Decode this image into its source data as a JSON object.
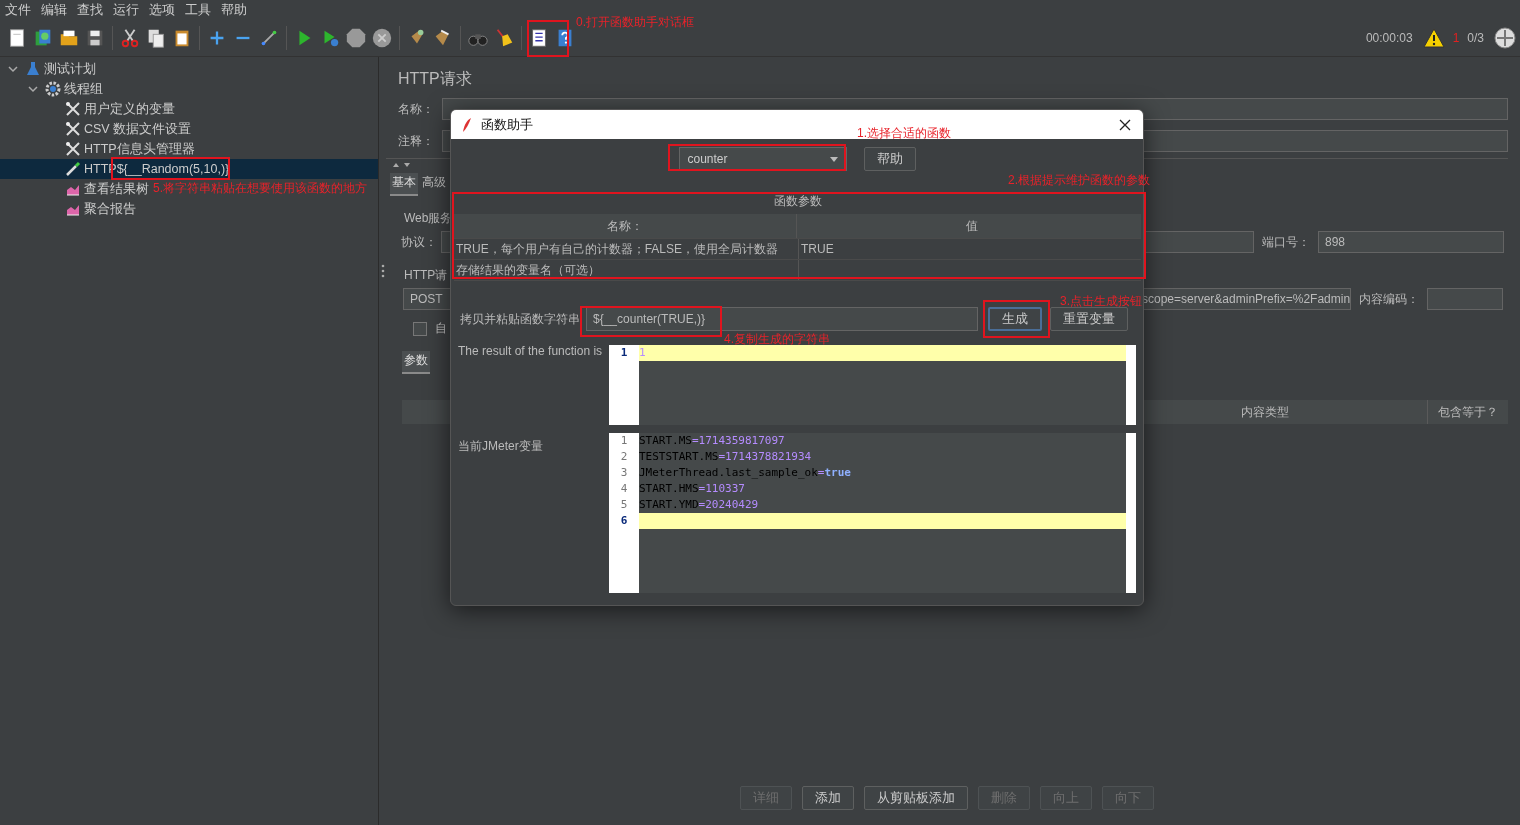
{
  "menu": [
    "文件",
    "编辑",
    "查找",
    "运行",
    "选项",
    "工具",
    "帮助"
  ],
  "status": {
    "elapsed": "00:00:03",
    "errors": "1",
    "threads": "0/3"
  },
  "tree": [
    {
      "label": "测试计划",
      "kind": "plan",
      "expanded": true,
      "selected": false,
      "children": [
        {
          "label": "线程组",
          "kind": "threads",
          "expanded": true,
          "selected": false,
          "children": [
            {
              "label": "用户定义的变量",
              "kind": "config",
              "selected": false
            },
            {
              "label": "CSV 数据文件设置",
              "kind": "config",
              "selected": false
            },
            {
              "label": "HTTP信息头管理器",
              "kind": "config",
              "selected": false
            },
            {
              "label": "HTTP${__Random(5,10,)}",
              "kind": "sampler",
              "selected": true
            },
            {
              "label": "查看结果树",
              "kind": "listener",
              "selected": false
            },
            {
              "label": "聚合报告",
              "kind": "listener",
              "selected": false
            }
          ]
        }
      ]
    }
  ],
  "sampler": {
    "title": "HTTP请求",
    "name_label": "名称：",
    "comment_label": "注释：",
    "tabs": [
      {
        "label": "基本",
        "selected": true
      },
      {
        "label": "高级",
        "selected": false
      }
    ],
    "web_group": "Web服务",
    "protocol_label": "协议：",
    "port_label": "端口号：",
    "port": "898",
    "request_group": "HTTP请",
    "method": "POST",
    "path": "scope=server&adminPrefix=%2Fadmin",
    "encoding_label": "内容编码：",
    "auto": {
      "label": "自",
      "checked": false
    },
    "param_tabs": [
      {
        "label": "参数",
        "selected": true
      }
    ],
    "columns": [
      "内容类型",
      "包含等于？"
    ],
    "buttons": [
      {
        "label": "详细",
        "disabled": true
      },
      {
        "label": "添加",
        "disabled": false
      },
      {
        "label": "从剪贴板添加",
        "disabled": false
      },
      {
        "label": "删除",
        "disabled": true
      },
      {
        "label": "向上",
        "disabled": true
      },
      {
        "label": "向下",
        "disabled": true
      }
    ]
  },
  "dialog": {
    "title": "函数助手",
    "function": "counter",
    "help_button": "帮助",
    "params_title": "函数参数",
    "param_columns": [
      "名称：",
      "值"
    ],
    "params": [
      {
        "name": "TRUE，每个用户有自己的计数器；FALSE，使用全局计数器",
        "value": "TRUE"
      },
      {
        "name": "存储结果的变量名（可选）"
      }
    ],
    "copy_label": "拷贝并粘贴函数字符串",
    "function_string": "${__counter(TRUE,)}",
    "generate_button": {
      "label": "生成",
      "focused": true
    },
    "reset_button": "重置变量",
    "result_label": "The result of the function is",
    "result_lines": [
      {
        "number": "1",
        "text": "1",
        "selected": true
      }
    ],
    "vars_label": "当前JMeter变量",
    "var_lines": [
      {
        "number": "1",
        "key": "START.MS",
        "sep": "=",
        "value": "1714359817097",
        "kind": "number",
        "selected": false
      },
      {
        "number": "2",
        "key": "TESTSTART.MS",
        "sep": "=",
        "value": "1714378821934",
        "kind": "number",
        "selected": false
      },
      {
        "number": "3",
        "key": "JMeterThread.last_sample_ok",
        "sep": "=",
        "value": "true",
        "kind": "boolean",
        "selected": false
      },
      {
        "number": "4",
        "key": "START.HMS",
        "sep": "=",
        "value": "110337",
        "kind": "number",
        "selected": false
      },
      {
        "number": "5",
        "key": "START.YMD",
        "sep": "=",
        "value": "20240429",
        "kind": "number",
        "selected": false
      },
      {
        "number": "6",
        "selected": true
      }
    ]
  },
  "annotations": [
    "0.打开函数助手对话框",
    "1.选择合适的函数",
    "2.根据提示维护函数的参数",
    "3.点击生成按钮",
    "4.复制生成的字符串",
    "5.将字符串粘贴在想要使用该函数的地方"
  ]
}
